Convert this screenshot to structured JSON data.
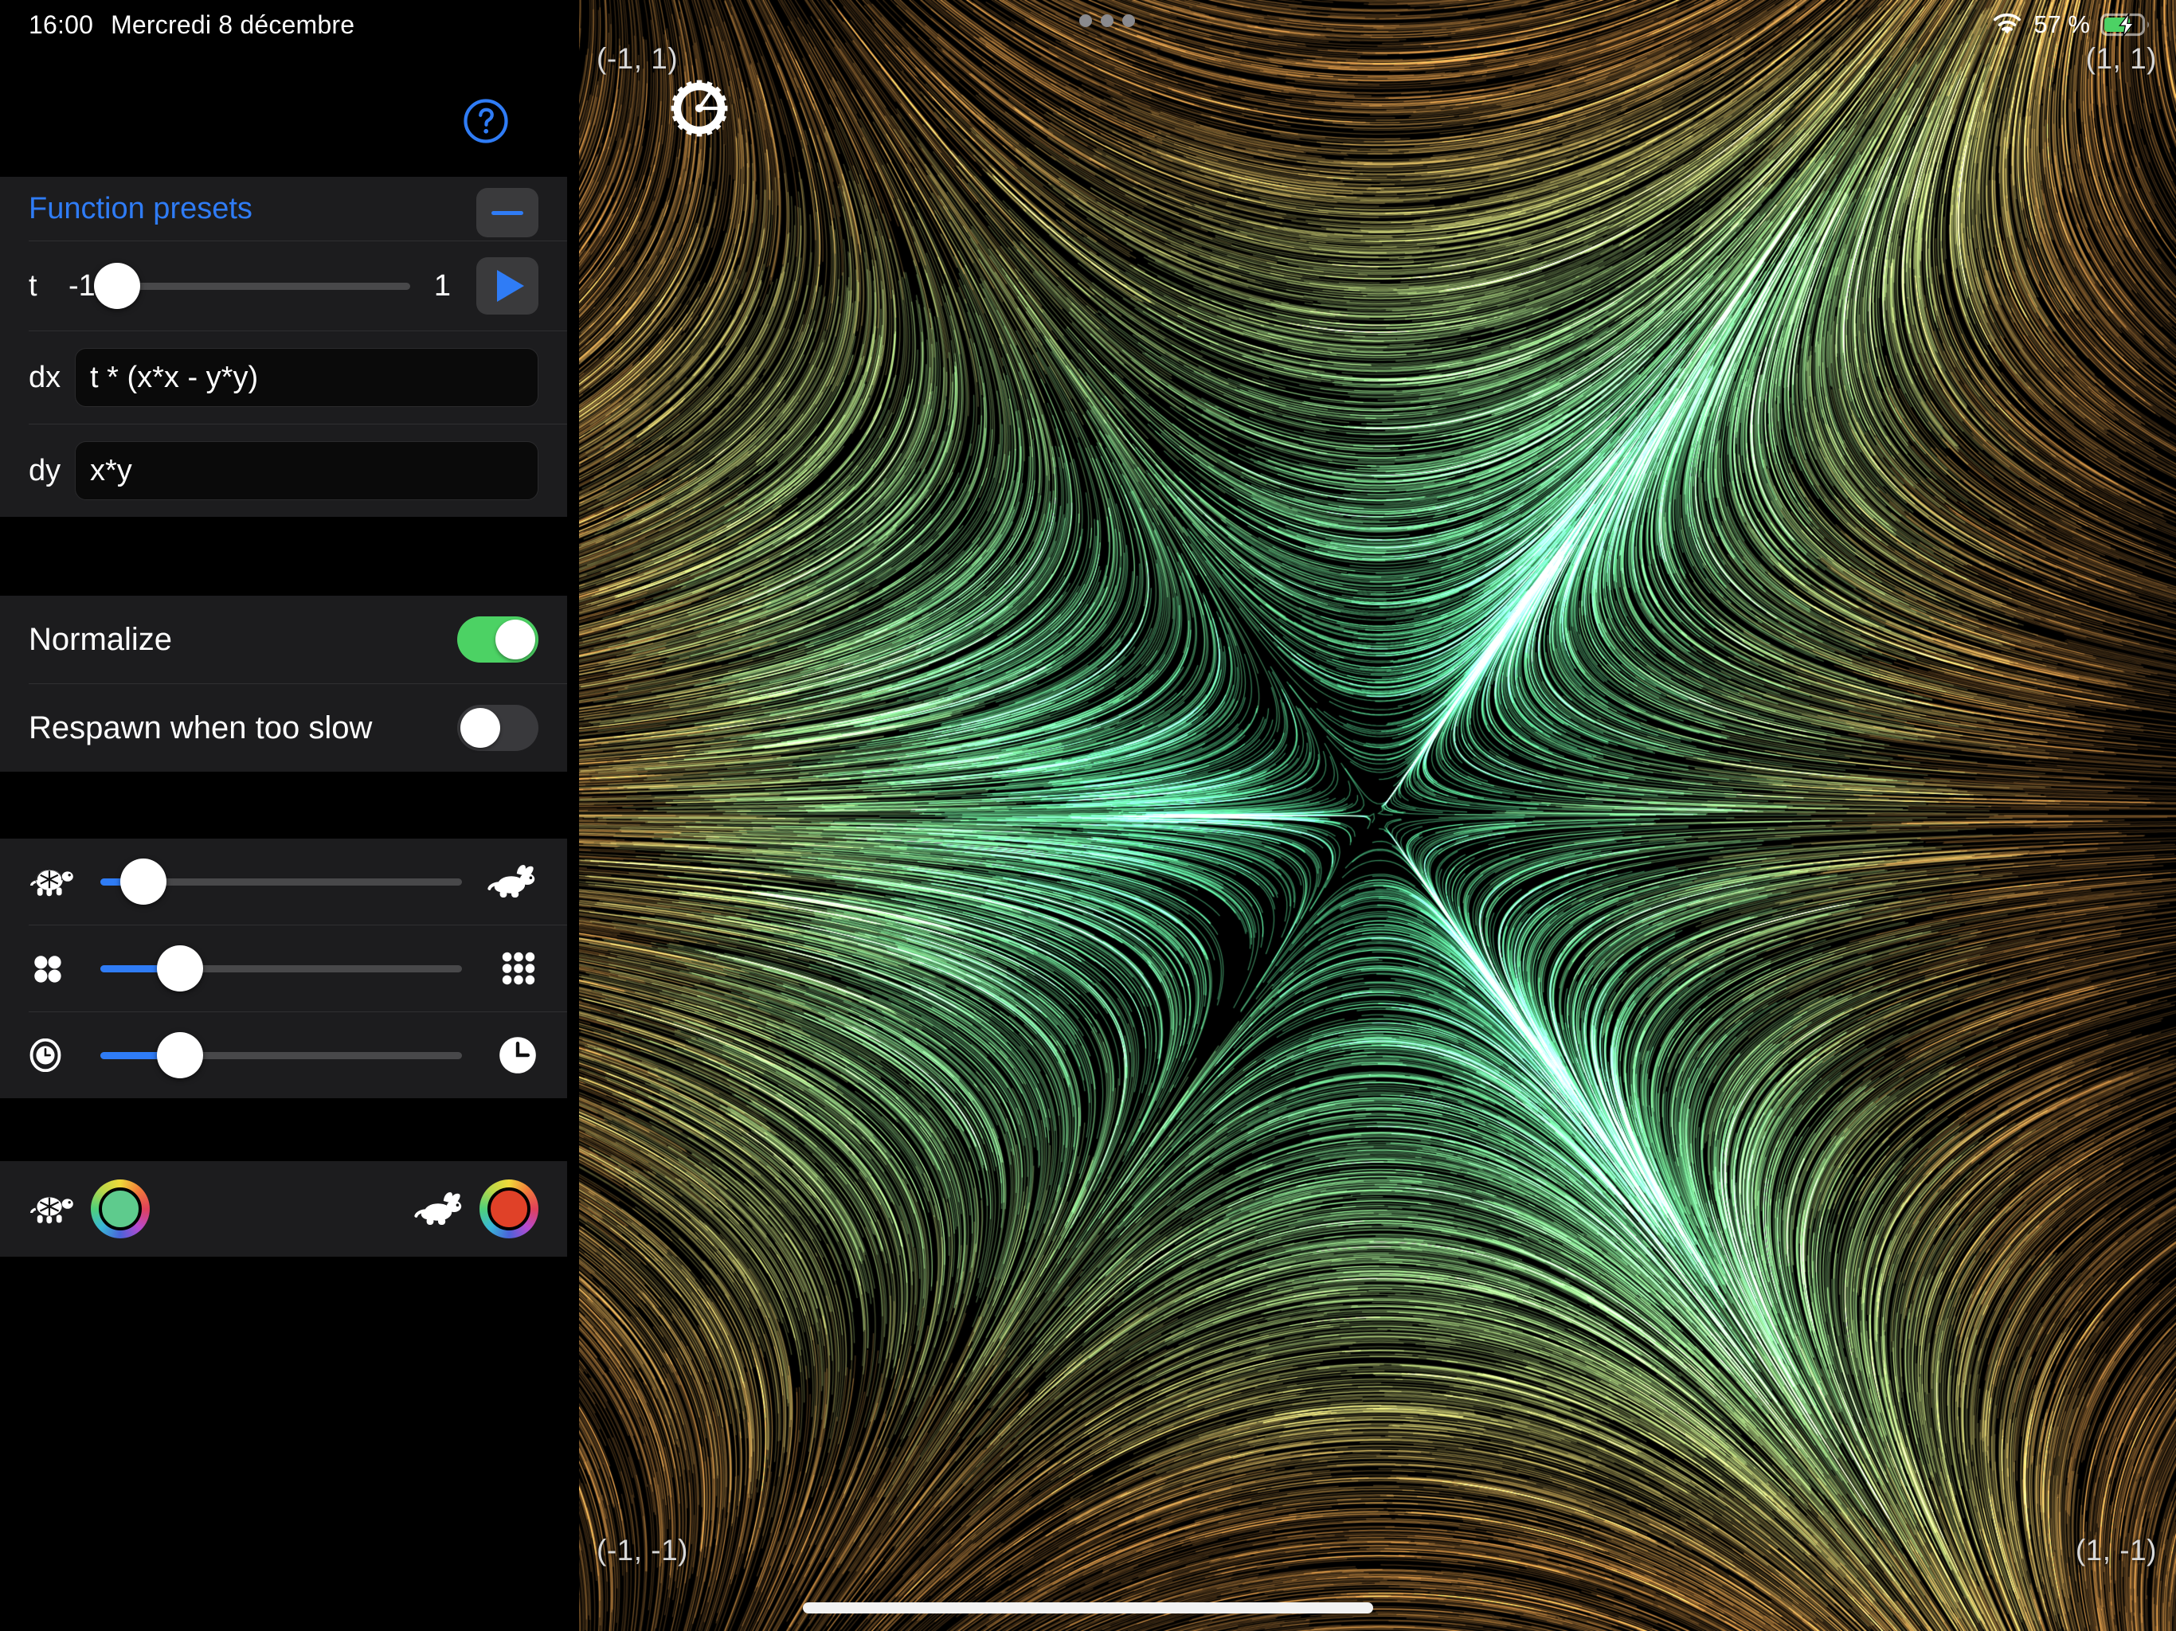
{
  "statusbar": {
    "time": "16:00",
    "date": "Mercredi 8 décembre",
    "battery_percent": "57 %",
    "wifi_icon": "wifi-icon",
    "battery_icon": "battery-charging-icon",
    "multitask_handle_icon": "three-dots-handle-icon",
    "battery_color": "#4cd264"
  },
  "sidebar": {
    "help_button": {
      "icon": "question-mark-circle-icon",
      "color": "#2f7cf6"
    },
    "presets": {
      "title": "Function presets",
      "collapse_icon": "minus-icon",
      "collapse_color": "#2f7cf6",
      "t_slider": {
        "label": "t",
        "min_label": "-1",
        "max_label": "1",
        "value_percent": 3,
        "play_icon": "play-triangle-icon",
        "accent": "#2f7cf6"
      },
      "fields": [
        {
          "label": "dx",
          "value": "t * (x*x - y*y)",
          "placeholder": "dx"
        },
        {
          "label": "dy",
          "value": "x*y",
          "placeholder": "dy"
        }
      ]
    },
    "toggles": [
      {
        "label": "Normalize",
        "state": "on",
        "on_color": "#4cd264"
      },
      {
        "label": "Respawn when too slow",
        "state": "off",
        "off_color": "#39393c"
      }
    ],
    "sliders": [
      {
        "name": "speed",
        "left_icon": "tortoise-icon",
        "right_icon": "hare-icon",
        "value_percent": 12,
        "accent": "#2f7cf6"
      },
      {
        "name": "particle-density",
        "left_icon": "four-dots-icon",
        "right_icon": "nine-dots-icon",
        "value_percent": 22,
        "accent": "#2f7cf6"
      },
      {
        "name": "trail-length",
        "left_icon": "small-clock-icon",
        "right_icon": "large-clock-icon",
        "value_percent": 22,
        "accent": "#2f7cf6"
      }
    ],
    "colors": [
      {
        "name": "slow-color",
        "icon": "tortoise-icon",
        "value": "#5ecb8d"
      },
      {
        "name": "fast-color",
        "icon": "hare-icon",
        "value": "#e04128"
      }
    ]
  },
  "canvas": {
    "settings_icon": "gear-icon",
    "corner_labels": {
      "top_left": "(-1, 1)",
      "top_right": "(1, 1)",
      "bottom_left": "(-1, -1)",
      "bottom_right": "(1, -1)"
    },
    "field_dx": "t * (x*x - y*y)",
    "field_dy": "x*y",
    "t_value": -1,
    "slow_color": "#b8803c",
    "fast_color": "#4fc98a",
    "background": "#000000"
  },
  "home_indicator": "home-indicator-bar"
}
